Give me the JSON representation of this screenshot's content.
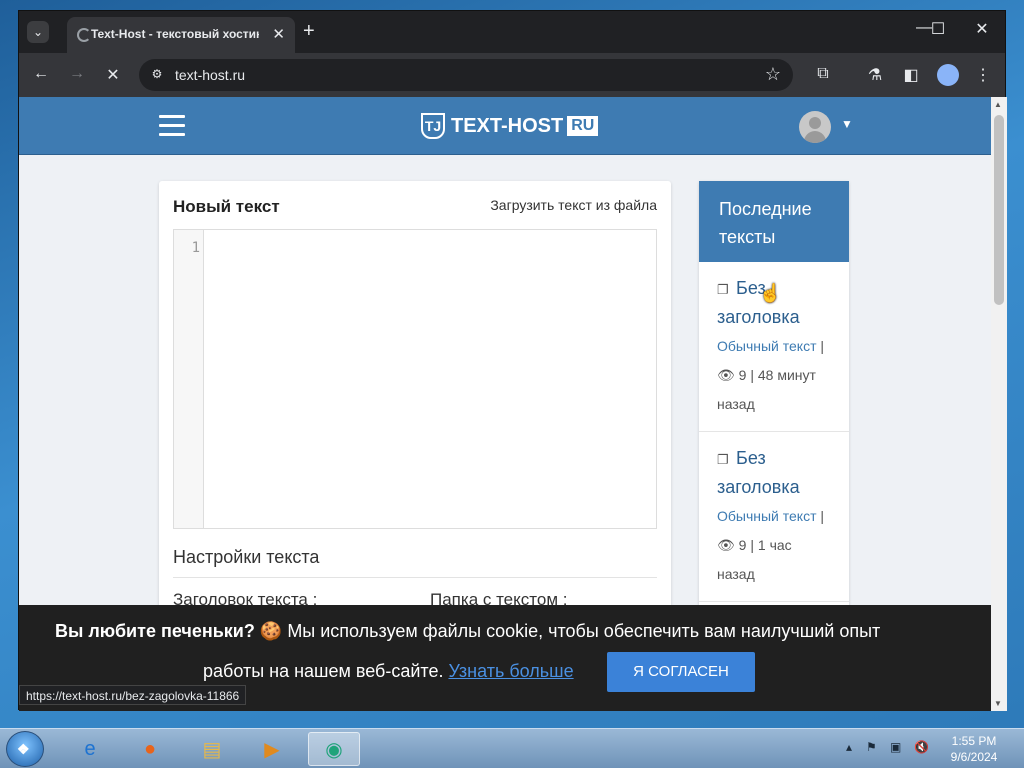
{
  "browser": {
    "tab_title": "Text-Host - текстовый хостинг",
    "tab_close": "✕",
    "new_tab": "+",
    "url": "text-host.ru",
    "status_url": "https://text-host.ru/bez-zagolovka-11866",
    "window_controls": [
      "—",
      "☐",
      "✕"
    ]
  },
  "site": {
    "logo_text": "TEXT-HOST",
    "logo_ru": "RU",
    "logo_badge": "TJ"
  },
  "editor": {
    "title": "Новый текст",
    "upload_link": "Загрузить текст из файла",
    "line_number": "1",
    "settings_title": "Настройки текста",
    "title_label": "Заголовок текста :",
    "folder_label": "Папка с текстом :"
  },
  "recent": {
    "heading": "Последние тексты",
    "items": [
      {
        "title": "Без заголовка",
        "type": "Обычный текст",
        "views": "9",
        "time": "48 минут назад"
      },
      {
        "title": "Без заголовка",
        "type": "Обычный текст",
        "views": "9",
        "time": "1 час назад"
      }
    ]
  },
  "cookie": {
    "question": "Вы любите печеньки?",
    "emoji": "🍪",
    "text_part1": "Мы используем файлы cookie, чтобы обеспечить вам наилучший опыт",
    "text_part2": "работы на нашем веб-сайте.",
    "learn_more": "Узнать больше",
    "accept": "Я СОГЛАСЕН"
  },
  "taskbar": {
    "time": "1:55 PM",
    "date": "9/6/2024",
    "apps": [
      "ie-icon",
      "firefox-icon",
      "explorer-icon",
      "media-player-icon",
      "active-app-icon"
    ]
  }
}
